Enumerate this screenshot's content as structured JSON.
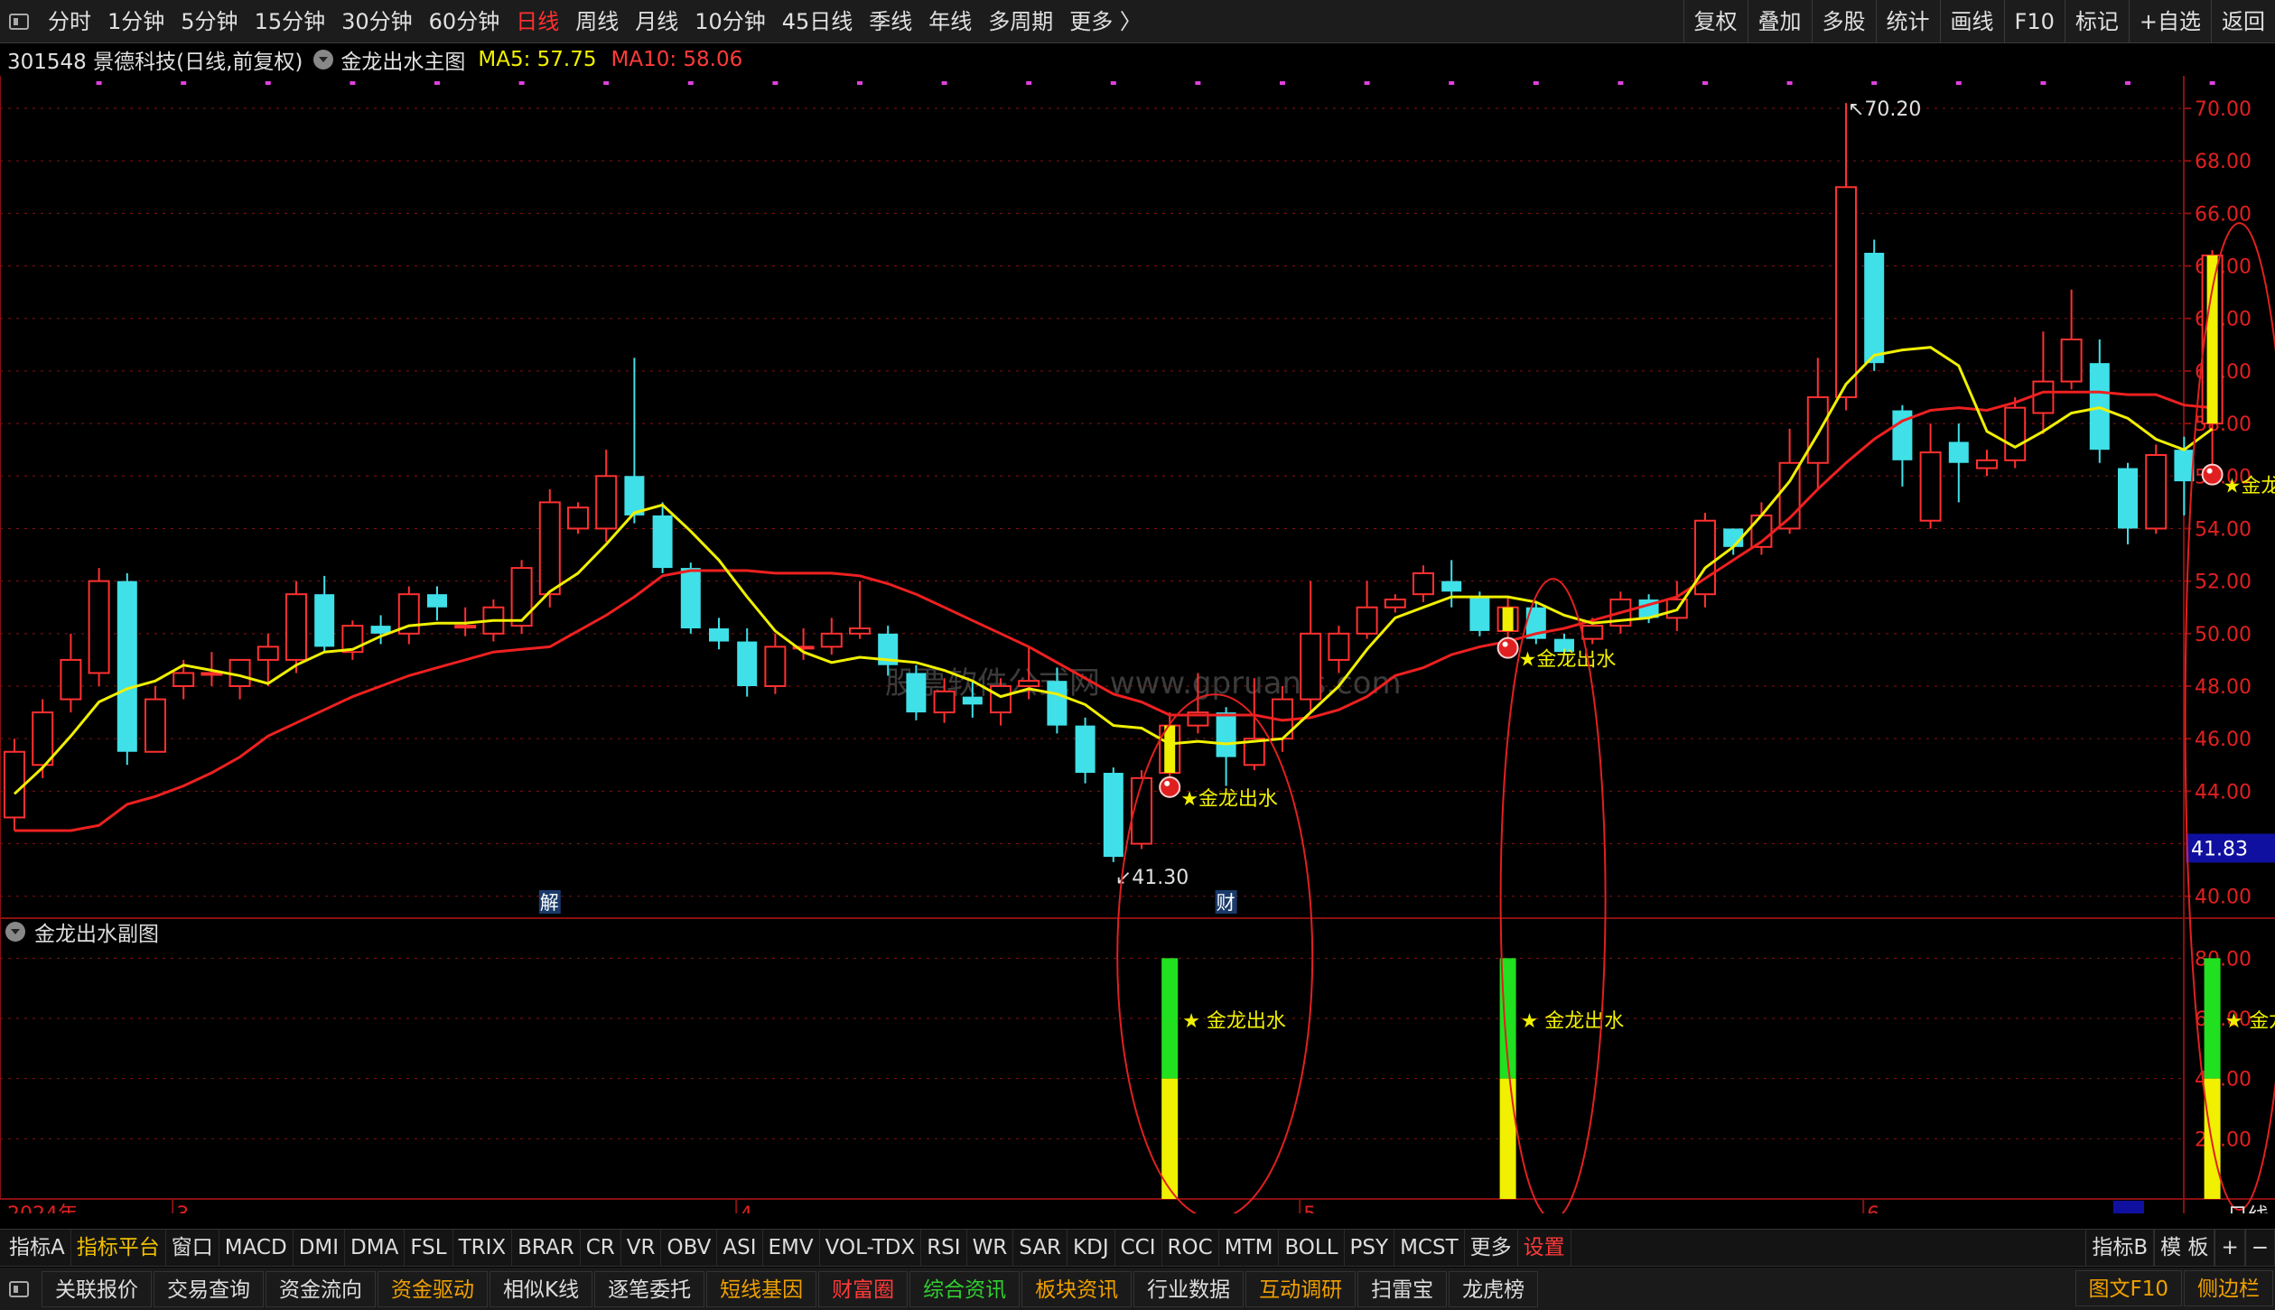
{
  "toolbar": {
    "periods": [
      "分时",
      "1分钟",
      "5分钟",
      "15分钟",
      "30分钟",
      "60分钟",
      "日线",
      "周线",
      "月线",
      "10分钟",
      "45日线",
      "季线",
      "年线",
      "多周期",
      "更多 〉"
    ],
    "active_period": "日线",
    "right_buttons": [
      "复权",
      "叠加",
      "多股",
      "统计",
      "画线",
      "F10",
      "标记",
      "+自选",
      "返回"
    ]
  },
  "info": {
    "stock": "301548 景德科技(日线,前复权)",
    "indicator": "金龙出水主图",
    "ma5": "MA5: 57.75",
    "ma10": "MA10: 58.06"
  },
  "colors": {
    "up": "#ff3030",
    "down": "#40e0e8",
    "ma5": "#f0f000",
    "ma10": "#ee2020",
    "signal": "#f0f000",
    "sub_green": "#20e020",
    "sub_yellow": "#f0f000",
    "grid": "#8a1010"
  },
  "chart_data": {
    "type": "candlestick",
    "price_axis": {
      "ticks": [
        "70.00",
        "68.00",
        "66.00",
        "64.00",
        "62.00",
        "60.00",
        "58.00",
        "56.00",
        "54.00",
        "52.00",
        "50.00",
        "48.00",
        "46.00",
        "44.00",
        "42.00",
        "40.00"
      ],
      "min": 39.2,
      "max": 71.1
    },
    "current_price": "41.83",
    "high_label": "70.20",
    "low_label": "41.30",
    "candles": [
      [
        43,
        45.5,
        42.5,
        46
      ],
      [
        45,
        47,
        44.5,
        47.5
      ],
      [
        47.5,
        49,
        47,
        50
      ],
      [
        48.5,
        52,
        48,
        52.5
      ],
      [
        52,
        45.5,
        45,
        52.3
      ],
      [
        45.5,
        47.5,
        45.5,
        48
      ],
      [
        48,
        48.5,
        47.5,
        49
      ],
      [
        48.5,
        48.5,
        48,
        49.3
      ],
      [
        48,
        49,
        47.5,
        49
      ],
      [
        49,
        49.5,
        48,
        50
      ],
      [
        49,
        51.5,
        48.5,
        52
      ],
      [
        51.5,
        49.5,
        49.3,
        52.2
      ],
      [
        49.3,
        50.3,
        49,
        50.5
      ],
      [
        50.3,
        50,
        49.6,
        50.7
      ],
      [
        50,
        51.5,
        49.6,
        51.8
      ],
      [
        51.5,
        51,
        50.5,
        51.8
      ],
      [
        50.3,
        50.3,
        49.9,
        51
      ],
      [
        50,
        51,
        49.7,
        51.3
      ],
      [
        50.3,
        52.5,
        50,
        52.8
      ],
      [
        51.5,
        55,
        51,
        55.5
      ],
      [
        54,
        54.8,
        53.8,
        55
      ],
      [
        54,
        56,
        53.5,
        57
      ],
      [
        56,
        54.5,
        54.2,
        60.5
      ],
      [
        54.5,
        52.5,
        52.3,
        55
      ],
      [
        52.5,
        50.2,
        50,
        52.7
      ],
      [
        50.2,
        49.7,
        49.4,
        50.6
      ],
      [
        49.7,
        48,
        47.6,
        50.2
      ],
      [
        48,
        49.5,
        47.7,
        50
      ],
      [
        49.5,
        49.5,
        49,
        50.2
      ],
      [
        49.5,
        50,
        49.2,
        50.6
      ],
      [
        50,
        50.2,
        49.8,
        52
      ],
      [
        50,
        48.8,
        48.4,
        50.3
      ],
      [
        48.5,
        47,
        46.7,
        48.8
      ],
      [
        47,
        47.8,
        46.6,
        48.3
      ],
      [
        47.6,
        47.3,
        46.8,
        48.2
      ],
      [
        47,
        48,
        46.5,
        48.3
      ],
      [
        48,
        48.2,
        47.5,
        49.5
      ],
      [
        48.2,
        46.5,
        46.2,
        48.7
      ],
      [
        46.5,
        44.7,
        44.3,
        46.8
      ],
      [
        44.7,
        41.5,
        41.3,
        44.9
      ],
      [
        42,
        44.5,
        41.8,
        44.8
      ],
      [
        44.7,
        46.5,
        44.5,
        47
      ],
      [
        46.5,
        47,
        46.2,
        48.5
      ],
      [
        47,
        45.3,
        44.2,
        47.2
      ],
      [
        45,
        46,
        44.8,
        48.3
      ],
      [
        46,
        47.5,
        45.5,
        48
      ],
      [
        47.5,
        50,
        47,
        52
      ],
      [
        49,
        50,
        48.5,
        50.3
      ],
      [
        50,
        51,
        49.8,
        52
      ],
      [
        51,
        51.3,
        50.8,
        51.5
      ],
      [
        51.5,
        52.3,
        51.2,
        52.6
      ],
      [
        52,
        51.6,
        51,
        52.8
      ],
      [
        51.4,
        50.1,
        49.9,
        51.6
      ],
      [
        50.1,
        51,
        49.8,
        51.4
      ],
      [
        51,
        49.8,
        49.6,
        51.2
      ],
      [
        49.8,
        49.3,
        49.2,
        50
      ],
      [
        49.8,
        50.3,
        49.6,
        50.6
      ],
      [
        50.3,
        51.3,
        50,
        51.6
      ],
      [
        51.3,
        50.6,
        50.4,
        51.5
      ],
      [
        50.6,
        51.3,
        50.1,
        52
      ],
      [
        51.5,
        54.3,
        51,
        54.6
      ],
      [
        54,
        53.3,
        53,
        54
      ],
      [
        53.3,
        54.5,
        53,
        55
      ],
      [
        54,
        56.5,
        53.8,
        57.8
      ],
      [
        56.5,
        59,
        55.5,
        60.5
      ],
      [
        59,
        67,
        58.5,
        70.2
      ],
      [
        64.5,
        60.3,
        60,
        65
      ],
      [
        58.5,
        56.6,
        55.6,
        58.7
      ],
      [
        54.3,
        56.9,
        54,
        58
      ],
      [
        57.3,
        56.5,
        55,
        58
      ],
      [
        56.3,
        56.6,
        56,
        57
      ],
      [
        56.6,
        58.6,
        56.3,
        59
      ],
      [
        58.4,
        59.6,
        57.6,
        61.5
      ],
      [
        59.6,
        61.2,
        59.3,
        63.1
      ],
      [
        60.3,
        57,
        56.5,
        61.2
      ],
      [
        56.3,
        54,
        53.4,
        56.5
      ],
      [
        54,
        56.8,
        53.8,
        57.2
      ],
      [
        57,
        55.8,
        54.5,
        57.5
      ],
      [
        58,
        64.4,
        56.4,
        64.6
      ]
    ],
    "ma5": [
      43.9,
      44.9,
      46.1,
      47.4,
      47.9,
      48.2,
      48.8,
      48.6,
      48.4,
      48.1,
      48.8,
      49.3,
      49.4,
      49.9,
      50.3,
      50.4,
      50.4,
      50.5,
      50.5,
      51.6,
      52.3,
      53.4,
      54.6,
      54.9,
      53.9,
      52.8,
      51.4,
      50.1,
      49.3,
      48.9,
      49.1,
      49,
      48.9,
      48.6,
      48.2,
      47.6,
      47.9,
      47.7,
      47.3,
      46.5,
      46.4,
      45.8,
      45.9,
      45.8,
      45.9,
      46,
      47,
      48,
      49.4,
      50.6,
      51,
      51.4,
      51.4,
      51.4,
      51.2,
      50.7,
      50.4,
      50.5,
      50.6,
      50.9,
      52.5,
      53.3,
      54.5,
      55.8,
      57.6,
      59.5,
      60.6,
      60.8,
      60.9,
      60.2,
      57.7,
      57.1,
      57.7,
      58.4,
      58.6,
      58.2,
      57.4,
      57,
      57.8
    ],
    "ma10": [
      42.5,
      42.5,
      42.5,
      42.7,
      43.5,
      43.8,
      44.2,
      44.7,
      45.3,
      46.1,
      46.6,
      47.1,
      47.6,
      48,
      48.4,
      48.7,
      49,
      49.3,
      49.4,
      49.5,
      50.1,
      50.7,
      51.4,
      52.2,
      52.4,
      52.4,
      52.4,
      52.3,
      52.3,
      52.3,
      52.2,
      51.9,
      51.5,
      51,
      50.5,
      50,
      49.5,
      48.9,
      48.3,
      47.7,
      47.4,
      46.9,
      46.9,
      46.9,
      46.9,
      46.7,
      46.8,
      47.1,
      47.6,
      48.4,
      48.7,
      49.2,
      49.5,
      49.7,
      50,
      50.2,
      50.5,
      50.8,
      51.1,
      51.4,
      52.1,
      52.8,
      53.5,
      54.4,
      55.5,
      56.5,
      57.4,
      58.1,
      58.5,
      58.6,
      58.5,
      58.8,
      59.2,
      59.2,
      59.2,
      59.1,
      59.1,
      58.7,
      58.6
    ],
    "signals": [
      {
        "index": 41,
        "label": "★金龙出水"
      },
      {
        "index": 53,
        "label": "★金龙出水"
      },
      {
        "index": 78,
        "label": "★金龙出z"
      }
    ],
    "event_markers": [
      {
        "index": 19,
        "text": "解"
      },
      {
        "index": 43,
        "text": "财"
      }
    ],
    "time_axis": [
      {
        "index": 0,
        "label": "2024年"
      },
      {
        "index": 6,
        "label": "3"
      },
      {
        "index": 26,
        "label": "4"
      },
      {
        "index": 46,
        "label": "5"
      },
      {
        "index": 66,
        "label": "6"
      }
    ],
    "sub_chart": {
      "title": "金龙出水副图",
      "ticks": [
        "80.00",
        "60.00",
        "40.00",
        "20.00"
      ],
      "min": 0,
      "max": 90,
      "bars": [
        {
          "index": 41,
          "yellow": 40,
          "green": 80,
          "label": "★ 金龙出水"
        },
        {
          "index": 53,
          "yellow": 40,
          "green": 80,
          "label": "★ 金龙出水"
        },
        {
          "index": 78,
          "yellow": 40,
          "green": 80,
          "label": "★ 金龙出"
        }
      ]
    },
    "watermark": "股票软件公式网 www.gpruanjs.com",
    "right_label": "日线",
    "scroll_label": "--"
  },
  "tabs": {
    "items": [
      "指标A",
      "指标平台",
      "窗口",
      "MACD",
      "DMI",
      "DMA",
      "FSL",
      "TRIX",
      "BRAR",
      "CR",
      "VR",
      "OBV",
      "ASI",
      "EMV",
      "VOL-TDX",
      "RSI",
      "WR",
      "SAR",
      "KDJ",
      "CCI",
      "ROC",
      "MTM",
      "BOLL",
      "PSY",
      "MCST",
      "更多",
      "设置"
    ],
    "right": [
      "指标B",
      "模 板",
      "+",
      "−"
    ]
  },
  "bottom": {
    "items": [
      {
        "t": "关联报价",
        "c": ""
      },
      {
        "t": "交易查询",
        "c": ""
      },
      {
        "t": "资金流向",
        "c": ""
      },
      {
        "t": "资金驱动",
        "c": "o"
      },
      {
        "t": "相似K线",
        "c": ""
      },
      {
        "t": "逐笔委托",
        "c": ""
      },
      {
        "t": "短线基因",
        "c": "o"
      },
      {
        "t": "财富圈",
        "c": "r"
      },
      {
        "t": "综合资讯",
        "c": "g"
      },
      {
        "t": "板块资讯",
        "c": "o"
      },
      {
        "t": "行业数据",
        "c": ""
      },
      {
        "t": "互动调研",
        "c": "o"
      },
      {
        "t": "扫雷宝",
        "c": ""
      },
      {
        "t": "龙虎榜",
        "c": ""
      }
    ],
    "right": [
      {
        "t": "图文F10",
        "c": "o"
      },
      {
        "t": "侧边栏",
        "c": "o"
      }
    ]
  }
}
